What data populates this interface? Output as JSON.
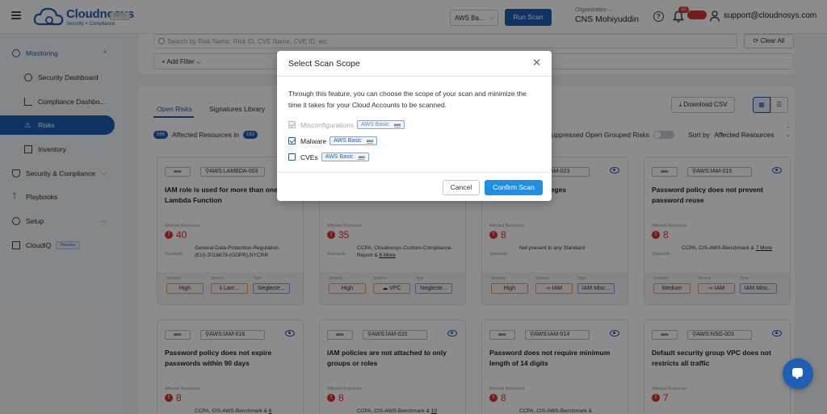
{
  "header": {
    "logo_name": "Cloudnosys",
    "logo_tagline": "Security + Compliance",
    "beta_label": "BETA",
    "scope_select_value": "AWS Ba...",
    "run_scan_label": "Run Scan",
    "org_label": "Organization",
    "org_name": "CNS Mohiyuddin",
    "notification_count": "10",
    "user_email": "support@cloudnosys.com"
  },
  "sidebar": {
    "monitoring": "Monitoring",
    "security_dashboard": "Security Dashboard",
    "compliance_dashboard": "Compliance Dashbo...",
    "risks": "Risks",
    "inventory": "Inventory",
    "security_compliance": "Security & Compliance",
    "playbooks": "Playbooks",
    "setup": "Setup",
    "cloudiq": "CloudIQ",
    "cloudiq_badge": "Preview"
  },
  "toolbar": {
    "search_placeholder": "Search by Risk Name, Risk ID, CVE Name, CVE ID, etc.",
    "clear_all": "Clear All",
    "add_filter": "+ Add Filter"
  },
  "content": {
    "tab_open_risks": "Open Risks",
    "tab_signatures": "Signatures Library",
    "download_csv": "Download CSV",
    "affected_count": "566",
    "affected_text": "Affected Resources in",
    "grouped_count": "163",
    "suppressed_label": "Suppressed Open Grouped Risks",
    "sort_label": "Sort by",
    "sort_value": "Affected Resources",
    "labels": {
      "affected_resources": "Affected Resources",
      "standards": "Standards",
      "severity": "Severity",
      "service": "Service",
      "type": "Type",
      "aws": "aws"
    }
  },
  "cards": [
    {
      "rule": "AWS:LAMBDA-003",
      "title": "IAM role is used for more than one Lambda Function",
      "count": "40",
      "standards": "General-Data-Protection-Regulation-(EU)-2016679-(GDPR),NYCRR",
      "more": "",
      "severity": "High",
      "service": "λ Lam...",
      "type": "Neglecte..."
    },
    {
      "rule": "AWS:IAM-002",
      "title": "",
      "count": "35",
      "standards": "CCPA, Cloudnosys-Custom-Compliance-Report &",
      "more": "6 More",
      "severity": "High",
      "service": "☁ VPC",
      "type": "Neglecte..."
    },
    {
      "rule": "AWS:IAM-023",
      "title": "...r-provisioned ...lleges",
      "count": "8",
      "standards": "Not present in any Standard",
      "more": "",
      "severity": "High",
      "service": "⊸ IAM",
      "type": "IAM Misc..."
    },
    {
      "rule": "AWS:IAM-015",
      "title": "Password policy does not prevent password reuse",
      "count": "8",
      "standards": "CCPA, CIS-AWS-Benchmark &",
      "more": "7 More",
      "severity": "Medium",
      "service": "⊸ IAM",
      "type": "IAM Misc..."
    },
    {
      "rule": "AWS:IAM-016",
      "title": "Password policy does not expire passwords within 90 days",
      "count": "8",
      "standards": "CCPA, CIS-AWS-Benchmark &",
      "more": "6",
      "severity": "",
      "service": "",
      "type": ""
    },
    {
      "rule": "AWS:IAM-020",
      "title": "IAM policies are not attached to only groups or roles",
      "count": "8",
      "standards": "CCPA, CIS-AWS-Benchmark &",
      "more": "10",
      "severity": "",
      "service": "",
      "type": ""
    },
    {
      "rule": "AWS:IAM-014",
      "title": "Password does not require minimum length of 14 digits",
      "count": "8",
      "standards": "CCPA, CIS-AWS-Benchmark &",
      "more": "",
      "severity": "",
      "service": "",
      "type": ""
    },
    {
      "rule": "AWS:NSG-003",
      "title": "Default security group VPC does not restricts all traffic",
      "count": "7",
      "standards": "",
      "more": "",
      "severity": "",
      "service": "",
      "type": ""
    }
  ],
  "modal": {
    "title": "Select Scan Scope",
    "description": "Through this feature, you can choose the scope of your scan and minimize the time it takes for your Cloud Accounts to be scanned.",
    "options": [
      {
        "label": "Misconfigurations",
        "chip": "AWS Basic",
        "checked": true,
        "disabled": true
      },
      {
        "label": "Malware",
        "chip": "AWS Basic",
        "checked": true,
        "disabled": false
      },
      {
        "label": "CVEs",
        "chip": "AWS Basic",
        "checked": false,
        "disabled": false
      }
    ],
    "chip_logo": "aws",
    "cancel": "Cancel",
    "confirm": "Confirm Scan"
  }
}
